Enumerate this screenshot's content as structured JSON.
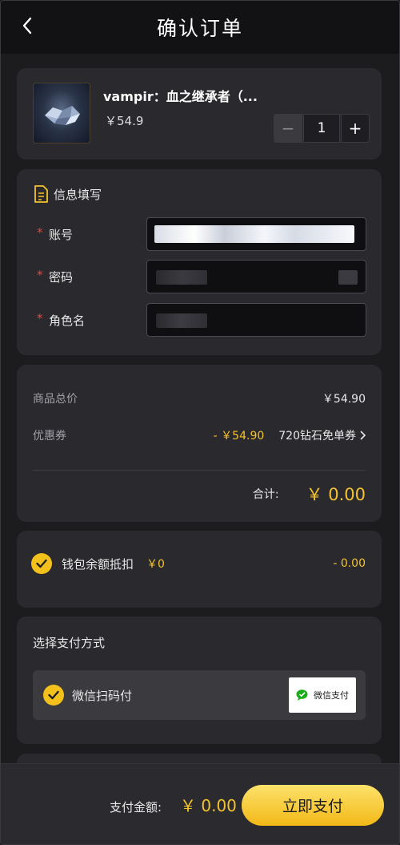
{
  "header": {
    "title": "确认订单",
    "back_icon": "chevron-left-icon"
  },
  "product": {
    "name": "vampir：血之继承者（...",
    "price": "￥54.9",
    "quantity": "1",
    "minus_label": "−",
    "plus_label": "+"
  },
  "info": {
    "title": "信息填写",
    "required_mark": "*",
    "fields": [
      {
        "label": "账号",
        "value": ""
      },
      {
        "label": "密码",
        "value": ""
      },
      {
        "label": "角色名",
        "value": ""
      }
    ]
  },
  "pricing": {
    "subtotal_label": "商品总价",
    "subtotal_value": "￥54.90",
    "coupon_label": "优惠券",
    "coupon_discount": "- ￥54.90",
    "coupon_name": "720钻石免单券",
    "total_label": "合计:",
    "total_value": "￥ 0.00"
  },
  "wallet": {
    "label": "钱包余额抵扣",
    "balance": "￥0",
    "deduction": "- 0.00"
  },
  "payment": {
    "title": "选择支付方式",
    "option_label": "微信扫码付",
    "logo_text": "微信支付"
  },
  "footer": {
    "amount_label": "支付金额:",
    "amount_value": "￥ 0.00",
    "pay_button": "立即支付"
  },
  "colors": {
    "accent": "#f3c22e",
    "required": "#e2463c",
    "card": "#2a2a2e",
    "background": "#1c1c1f"
  }
}
